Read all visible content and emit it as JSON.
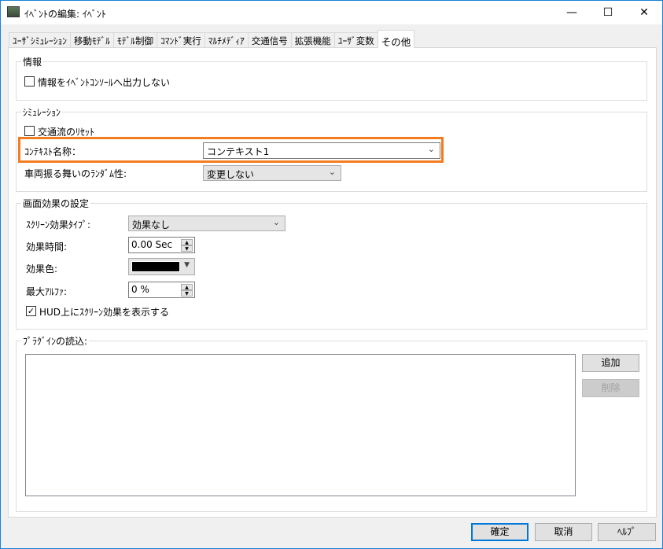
{
  "window": {
    "title": "ｲﾍﾞﾝﾄの編集: ｲﾍﾞﾝﾄ",
    "minimize": "—",
    "maximize": "☐",
    "close": "✕"
  },
  "tabs": [
    {
      "label": "ﾕｰｻﾞｼﾐｭﾚｰｼｮﾝ"
    },
    {
      "label": "移動ﾓﾃﾞﾙ"
    },
    {
      "label": "ﾓﾃﾞﾙ制御"
    },
    {
      "label": "ｺﾏﾝﾄﾞ実行"
    },
    {
      "label": "ﾏﾙﾁﾒﾃﾞｨｱ"
    },
    {
      "label": "交通信号"
    },
    {
      "label": "拡張機能"
    },
    {
      "label": "ﾕｰｻﾞ変数"
    },
    {
      "label": "その他",
      "active": true
    }
  ],
  "info": {
    "title": "情報",
    "no_output": {
      "label": "情報をｲﾍﾞﾝﾄｺﾝｿｰﾙへ出力しない",
      "checked": false
    }
  },
  "simulation": {
    "title": "ｼﾐｭﾚｰｼｮﾝ",
    "reset": {
      "label": "交通流のﾘｾｯﾄ",
      "checked": false
    },
    "context_label": "ｺﾝﾃｷｽﾄ名称：",
    "context_value": "コンテキスト1",
    "random_label": "車両振る舞いのﾗﾝﾀﾞﾑ性:",
    "random_value": "変更しない"
  },
  "screen": {
    "title": "画面効果の設定",
    "type_label": "ｽｸﾘｰﾝ効果ﾀｲﾌﾟ:",
    "type_value": "効果なし",
    "time_label": "効果時間:",
    "time_value": "0.00 Sec",
    "color_label": "効果色:",
    "color_value": "#000000",
    "alpha_label": "最大ｱﾙﾌｧ:",
    "alpha_value": "0 %",
    "hud": {
      "label": "HUD上にｽｸﾘｰﾝ効果を表示する",
      "checked": true
    }
  },
  "plugin": {
    "title": "ﾌﾟﾗｸﾞｲﾝの読込:",
    "add": "追加",
    "remove": "削除"
  },
  "footer": {
    "ok": "確定",
    "cancel": "取消",
    "help": "ﾍﾙﾌﾟ"
  }
}
